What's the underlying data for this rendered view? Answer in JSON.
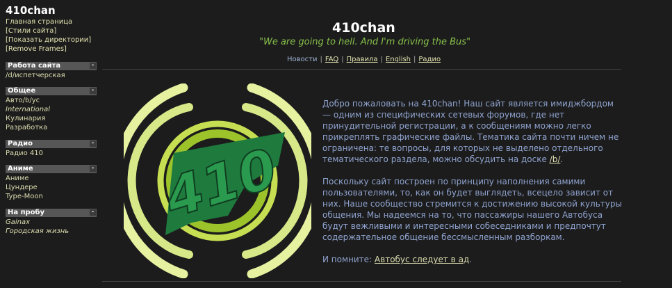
{
  "sidebar": {
    "title": "410chan",
    "links": [
      "Главная страница",
      "[Стили сайта]",
      "[Показать директории]",
      "[Remove Frames]"
    ],
    "sections": [
      {
        "title": "Работа сайта",
        "toggle": "-",
        "items": [
          {
            "label": "/d/испетчерская"
          }
        ]
      },
      {
        "title": "Общее",
        "toggle": "-",
        "items": [
          {
            "label": "Авто/b/ус"
          },
          {
            "label": "International"
          },
          {
            "label": "Кулинария"
          },
          {
            "label": "Разработка"
          }
        ]
      },
      {
        "title": "Радио",
        "toggle": "-",
        "items": [
          {
            "label": "Радио 410"
          }
        ]
      },
      {
        "title": "Аниме",
        "toggle": "-",
        "items": [
          {
            "label": "Аниме"
          },
          {
            "label": "Цундере"
          },
          {
            "label": "Type-Moon"
          }
        ]
      },
      {
        "title": "На пробу",
        "toggle": "-",
        "items": [
          {
            "label": "Gainax"
          },
          {
            "label": "Городская жизнь"
          }
        ]
      }
    ]
  },
  "header": {
    "title": "410chan",
    "slogan": "\"We are going to hell. And I'm driving the Bus\""
  },
  "nav": [
    "Новости",
    "FAQ",
    "Правила",
    "English",
    "Радио"
  ],
  "nav_separator": "|",
  "logo": {
    "text": "410",
    "colors": {
      "ring_light": "#e6f2a0",
      "ring_mid": "#c6df52",
      "ring_dark": "#9cc42a",
      "badge": "#1f7a3e"
    }
  },
  "content": {
    "p1_text": "Добро пожаловать на 410chan! Наш сайт является имиджбордом — одним из специфических сетевых форумов, где нет принудительной регистрации, а к сообщениям можно легко прикреплять графические файлы. Тематика сайта почти ничем не ограничена: те вопросы, для которых не выделено отдельного тематического раздела, можно обсудить на доске",
    "p1_link": "/b/",
    "p1_end": ".",
    "p2": "Поскольку сайт построен по принципу наполнения самими пользователями, то, как он будет выглядеть, всецело зависит от них. Наше сообщество стремится к достижению высокой культуры общения. Мы надеемся на то, что пассажиры нашего Автобуса будут вежливыми и интересными собеседниками и предпочтут содержательное общение бессмысленным разборкам.",
    "p3_text": "И помните:",
    "p3_link": "Автобус следует в ад",
    "p3_end": "."
  }
}
